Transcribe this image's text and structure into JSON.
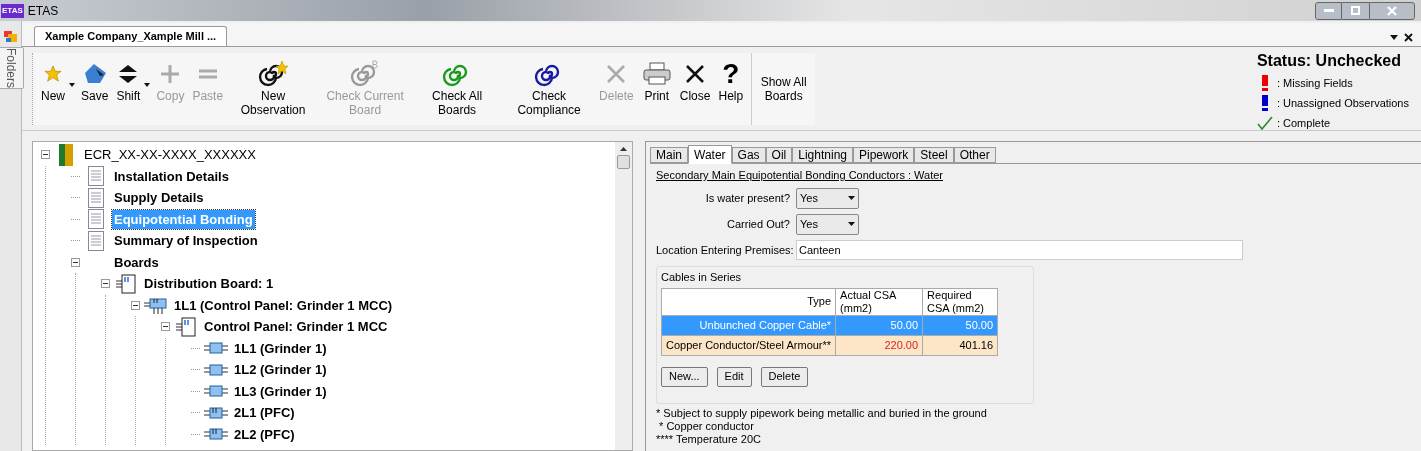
{
  "window": {
    "title": "ETAS",
    "logo": "ETAS"
  },
  "side_strip": {
    "label": "Folders"
  },
  "document_tab": {
    "label": "Xample Company_Xample Mill ...",
    "selected": true
  },
  "toolbar": [
    {
      "kind": "new",
      "label": "New",
      "disabled": false,
      "dropdown": true
    },
    {
      "kind": "save",
      "label": "Save",
      "disabled": false,
      "dropdown": false
    },
    {
      "kind": "shift",
      "label": "Shift",
      "disabled": false,
      "dropdown": true
    },
    {
      "kind": "copy",
      "label": "Copy",
      "disabled": true,
      "dropdown": false
    },
    {
      "kind": "paste",
      "label": "Paste",
      "disabled": true,
      "dropdown": false
    },
    {
      "kind": "new-observation",
      "label": "New Observation",
      "disabled": false,
      "dropdown": false
    },
    {
      "kind": "check-current",
      "label": "Check Current Board",
      "disabled": true,
      "dropdown": false
    },
    {
      "kind": "check-all",
      "label": "Check All Boards",
      "disabled": false,
      "dropdown": false
    },
    {
      "kind": "check-compliance",
      "label": "Check Compliance",
      "disabled": false,
      "dropdown": false
    },
    {
      "kind": "delete",
      "label": "Delete",
      "disabled": true,
      "dropdown": false
    },
    {
      "kind": "print",
      "label": "Print",
      "disabled": false,
      "dropdown": false
    },
    {
      "kind": "close",
      "label": "Close",
      "disabled": false,
      "dropdown": false
    },
    {
      "kind": "help",
      "label": "Help",
      "disabled": false,
      "dropdown": false,
      "glyph": "?"
    },
    {
      "kind": "text",
      "label": "Show All Boards",
      "disabled": false
    }
  ],
  "status": {
    "title": "Status: Unchecked",
    "legend": [
      {
        "kind": "missing",
        "label": ": Missing Fields"
      },
      {
        "kind": "unassigned",
        "label": ": Unassigned Observations"
      },
      {
        "kind": "complete",
        "label": ": Complete"
      }
    ]
  },
  "tree": {
    "label": "ECR_XX-XX-XXXX_XXXXXX",
    "kind": "root",
    "expanded": true,
    "selected": false,
    "children": [
      {
        "label": "Installation Details",
        "kind": "page",
        "selected": false
      },
      {
        "label": "Supply Details",
        "kind": "page",
        "selected": false
      },
      {
        "label": "Equipotential Bonding",
        "kind": "page",
        "selected": true
      },
      {
        "label": "Summary of Inspection",
        "kind": "page",
        "selected": false
      },
      {
        "label": "Boards",
        "kind": "group",
        "expanded": true,
        "selected": false,
        "children": [
          {
            "label": "Distribution Board: 1",
            "kind": "board",
            "expanded": true,
            "selected": false,
            "children": [
              {
                "label": "1L1 (Control Panel: Grinder 1 MCC)",
                "kind": "feed",
                "expanded": true,
                "selected": false,
                "children": [
                  {
                    "label": "Control Panel: Grinder 1 MCC",
                    "kind": "board",
                    "expanded": true,
                    "selected": false,
                    "children": [
                      {
                        "label": "1L1 (Grinder 1)",
                        "kind": "circuit",
                        "selected": false
                      },
                      {
                        "label": "1L2 (Grinder 1)",
                        "kind": "circuit",
                        "selected": false
                      },
                      {
                        "label": "1L3 (Grinder 1)",
                        "kind": "circuit",
                        "selected": false
                      },
                      {
                        "label": "2L1 (PFC)",
                        "kind": "feed-small",
                        "selected": false
                      },
                      {
                        "label": "2L2 (PFC)",
                        "kind": "feed-small",
                        "selected": false
                      }
                    ]
                  }
                ]
              }
            ]
          }
        ]
      }
    ]
  },
  "tabs": [
    {
      "label": "Main",
      "selected": false
    },
    {
      "label": "Water",
      "selected": true
    },
    {
      "label": "Gas",
      "selected": false
    },
    {
      "label": "Oil",
      "selected": false
    },
    {
      "label": "Lightning",
      "selected": false
    },
    {
      "label": "Pipework",
      "selected": false
    },
    {
      "label": "Steel",
      "selected": false
    },
    {
      "label": "Other",
      "selected": false
    }
  ],
  "section_title": "Secondary Main Equipotential Bonding Conductors : Water",
  "fields": [
    {
      "kind": "select",
      "label": "Is water present?",
      "value": "Yes"
    },
    {
      "kind": "select",
      "label": "Carried Out?",
      "value": "Yes"
    },
    {
      "kind": "text",
      "label": "Location Entering Premises:",
      "value": "Canteen"
    }
  ],
  "cables": {
    "title": "Cables in Series",
    "columns": [
      "Type",
      "Actual CSA (mm2)",
      "Required CSA (mm2)"
    ],
    "rows": [
      {
        "type": "Unbunched Copper Cable*",
        "actual": "50.00",
        "required": "50.00",
        "selected": true,
        "warning": false
      },
      {
        "type": "Copper Conductor/Steel Armour**",
        "actual": "220.00",
        "required": "401.16",
        "selected": false,
        "warning": true
      }
    ],
    "buttons": [
      "New...",
      "Edit",
      "Delete"
    ]
  },
  "notes": [
    "* Subject to supply pipework being metallic and buried in the ground",
    " * Copper conductor",
    "**** Temperature 20C"
  ]
}
